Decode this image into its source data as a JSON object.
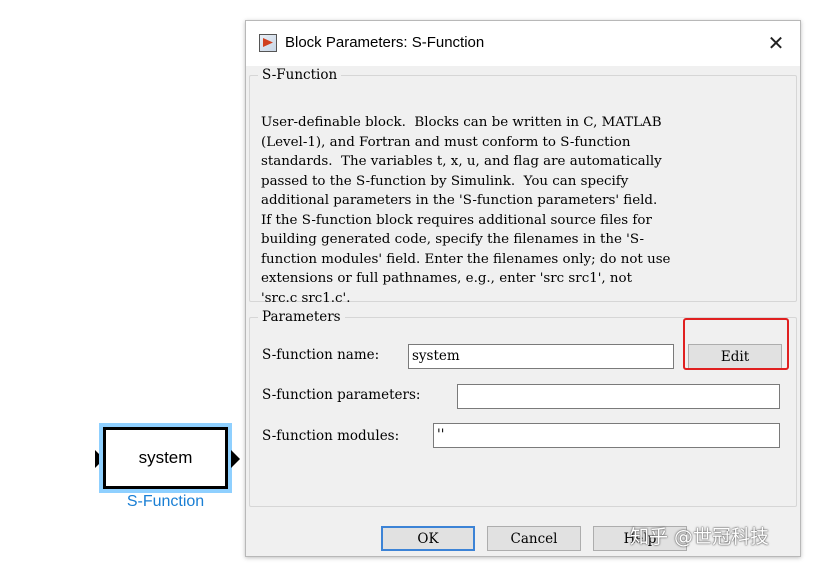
{
  "canvas": {
    "block_text": "system",
    "block_caption": "S-Function"
  },
  "dialog": {
    "title": "Block Parameters: S-Function",
    "close_glyph": "✕",
    "description_legend": "S-Function",
    "description": "User-definable block.  Blocks can be written in C, MATLAB\n(Level-1), and Fortran and must conform to S-function\nstandards.  The variables t, x, u, and flag are automatically\npassed to the S-function by Simulink.  You can specify\nadditional parameters in the 'S-function parameters' field.\nIf the S-function block requires additional source files for\nbuilding generated code, specify the filenames in the 'S-\nfunction modules' field. Enter the filenames only; do not use\nextensions or full pathnames, e.g., enter 'src src1', not\n'src.c src1.c'.",
    "parameters_legend": "Parameters",
    "sfunction_name_label": "S-function name:",
    "sfunction_name_value": "system",
    "edit_label": "Edit",
    "sfunction_parameters_label": "S-function parameters:",
    "sfunction_parameters_value": "",
    "sfunction_modules_label": "S-function modules:",
    "sfunction_modules_value": "''",
    "ok_label": "OK",
    "cancel_label": "Cancel",
    "help_label": "Help"
  },
  "watermark": "知乎 @世冠科技",
  "colors": {
    "block_highlight": "#8fd0ff",
    "caption": "#1a7fd4",
    "annotation_box": "#e02020",
    "default_button_border": "#3c83d6"
  }
}
